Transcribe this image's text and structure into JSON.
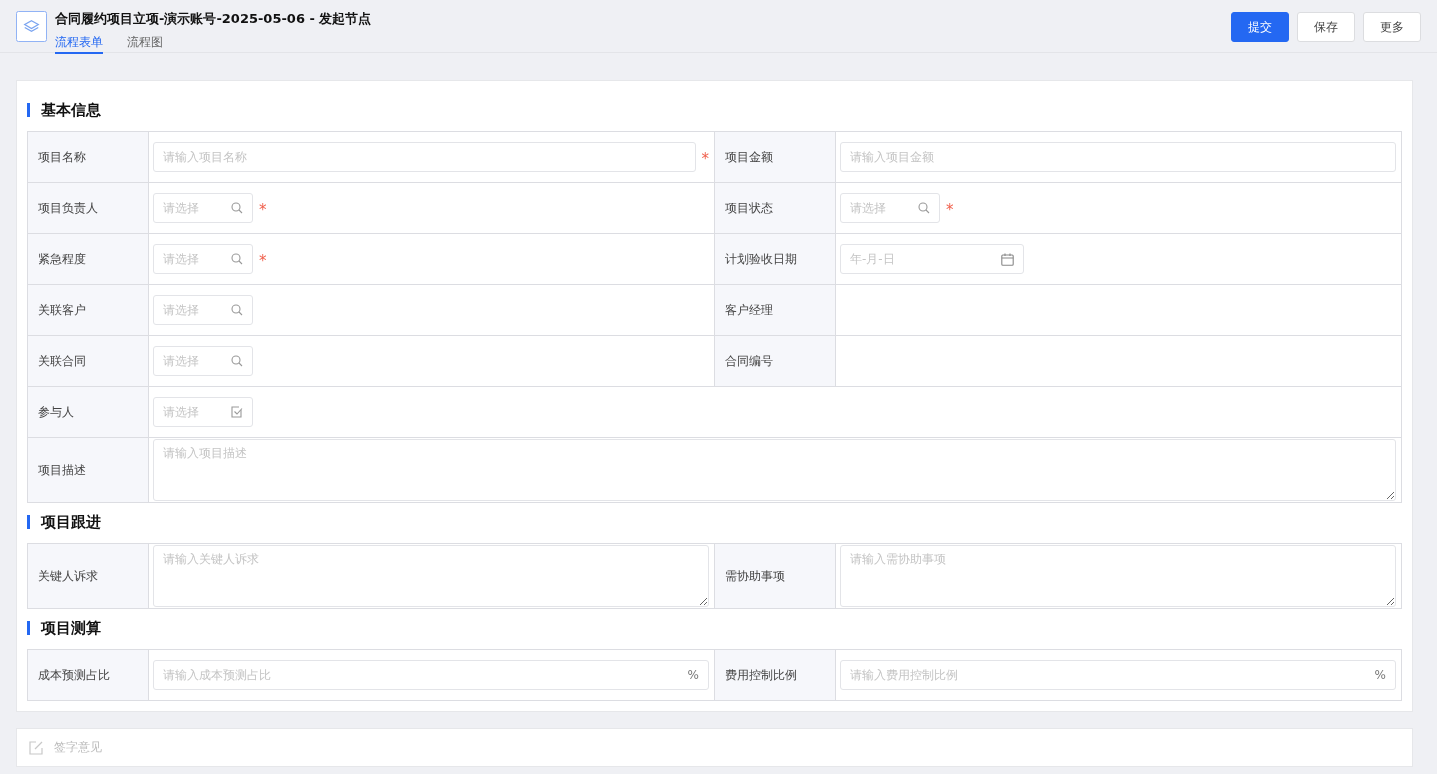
{
  "header": {
    "title": "合同履约项目立项-演示账号-2025-05-06 - 发起节点",
    "tabs": [
      {
        "label": "流程表单",
        "selected": true
      },
      {
        "label": "流程图",
        "selected": false
      }
    ],
    "buttons": [
      {
        "label": "提交",
        "kind": "primary"
      },
      {
        "label": "保存",
        "kind": "default"
      },
      {
        "label": "更多",
        "kind": "default"
      }
    ]
  },
  "sections": [
    {
      "title": "基本信息",
      "rows": [
        [
          {
            "label": "项目名称",
            "kind": "text",
            "placeholder": "请输入项目名称",
            "mark": "*"
          },
          {
            "label": "项目金额",
            "kind": "text",
            "placeholder": "请输入项目金额"
          }
        ],
        [
          {
            "label": "项目负责人",
            "kind": "select",
            "placeholder": "请选择",
            "mark": "*"
          },
          {
            "label": "项目状态",
            "kind": "select",
            "placeholder": "请选择",
            "mark": "*"
          }
        ],
        [
          {
            "label": "紧急程度",
            "kind": "select",
            "placeholder": "请选择",
            "mark": "*"
          },
          {
            "label": "计划验收日期",
            "kind": "date",
            "placeholder": "年-月-日"
          }
        ],
        [
          {
            "label": "关联客户",
            "kind": "select",
            "placeholder": "请选择"
          },
          {
            "label": "客户经理",
            "kind": "empty"
          }
        ],
        [
          {
            "label": "关联合同",
            "kind": "select",
            "placeholder": "请选择"
          },
          {
            "label": "合同编号",
            "kind": "empty"
          }
        ],
        [
          {
            "label": "参与人",
            "kind": "multiselect",
            "placeholder": "请选择"
          }
        ],
        [
          {
            "label": "项目描述",
            "kind": "textarea",
            "placeholder": "请输入项目描述"
          }
        ]
      ]
    },
    {
      "title": "项目跟进",
      "rows": [
        [
          {
            "label": "关键人诉求",
            "kind": "textarea",
            "placeholder": "请输入关键人诉求"
          },
          {
            "label": "需协助事项",
            "kind": "textarea",
            "placeholder": "请输入需协助事项"
          }
        ]
      ]
    },
    {
      "title": "项目测算",
      "rows": [
        [
          {
            "label": "成本预测占比",
            "kind": "percent",
            "placeholder": "请输入成本预测占比",
            "suffix": "%"
          },
          {
            "label": "费用控制比例",
            "kind": "percent",
            "placeholder": "请输入费用控制比例",
            "suffix": "%"
          }
        ]
      ]
    }
  ],
  "signature": {
    "label": "签字意见"
  }
}
